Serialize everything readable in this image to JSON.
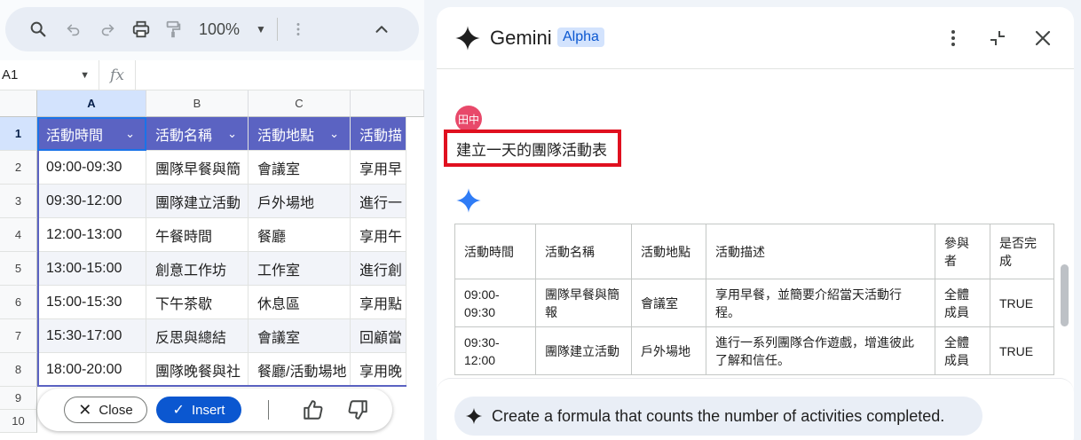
{
  "toolbar": {
    "zoom": "100%"
  },
  "formula_bar": {
    "cell_ref": "A1",
    "fx_label": "fx"
  },
  "sheet": {
    "columns": [
      "A",
      "B",
      "C"
    ],
    "rows": [
      "1",
      "2",
      "3",
      "4",
      "5",
      "6",
      "7",
      "8",
      "9",
      "10"
    ],
    "header": [
      "活動時間",
      "活動名稱",
      "活動地點",
      "活動描"
    ],
    "data": [
      [
        "09:00-09:30",
        "團隊早餐與簡",
        "會議室",
        "享用早"
      ],
      [
        "09:30-12:00",
        "團隊建立活動",
        "戶外場地",
        "進行一"
      ],
      [
        "12:00-13:00",
        "午餐時間",
        "餐廳",
        "享用午"
      ],
      [
        "13:00-15:00",
        "創意工作坊",
        "工作室",
        "進行創"
      ],
      [
        "15:00-15:30",
        "下午茶歇",
        "休息區",
        "享用點"
      ],
      [
        "15:30-17:00",
        "反思與總結",
        "會議室",
        "回顧當"
      ],
      [
        "18:00-20:00",
        "團隊晚餐與社",
        "餐廳/活動場地",
        "享用晚"
      ]
    ]
  },
  "actions": {
    "close_label": "Close",
    "insert_label": "Insert"
  },
  "gemini": {
    "title": "Gemini",
    "badge": "Alpha",
    "user_initials": "田中",
    "prompt": "建立一天的團隊活動表",
    "table": {
      "headers": [
        "活動時間",
        "活動名稱",
        "活動地點",
        "活動描述",
        "參與者",
        "是否完成"
      ],
      "rows": [
        [
          "09:00-09:30",
          "團隊早餐與簡報",
          "會議室",
          "享用早餐，並簡要介紹當天活動行程。",
          "全體成員",
          "TRUE"
        ],
        [
          "09:30-12:00",
          "團隊建立活動",
          "戶外場地",
          "進行一系列團隊合作遊戲，增進彼此了解和信任。",
          "全體成員",
          "TRUE"
        ]
      ]
    },
    "suggestion": "Create a formula that counts the number of activities completed."
  },
  "colors": {
    "table_header_bg": "#5b63c2",
    "selection_blue": "#1a73e8",
    "insert_button": "#0b57d0",
    "highlight_red": "#e0101f",
    "avatar": "#e8496a"
  }
}
